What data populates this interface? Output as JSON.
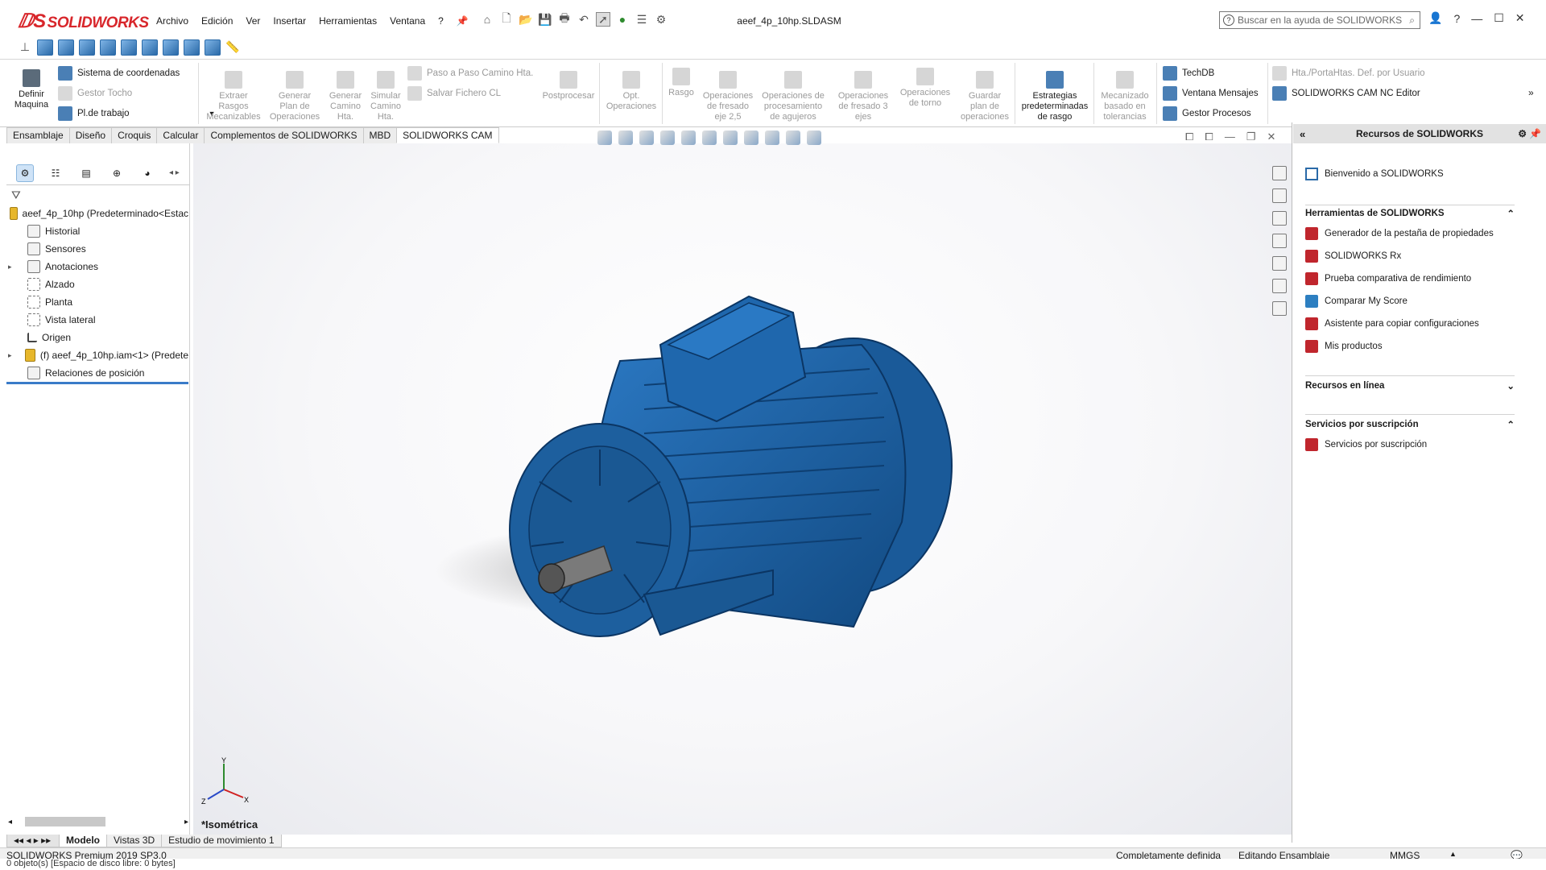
{
  "app": {
    "logo": "SOLIDWORKS",
    "doc_title": "aeef_4p_10hp.SLDASM",
    "menu": [
      "Archivo",
      "Edición",
      "Ver",
      "Insertar",
      "Herramientas",
      "Ventana",
      "?"
    ],
    "search_placeholder": "Buscar en la ayuda de SOLIDWORKS"
  },
  "ribbon": {
    "definir": "Definir\nMaquina",
    "coord": "Sistema de coordenadas",
    "gestor_tocho": "Gestor Tocho",
    "pl_trabajo": "Pl.de trabajo",
    "extraer": "Extraer\nRasgos\nMecanizables",
    "generar_plan": "Generar\nPlan de\nOperaciones",
    "generar_camino": "Generar\nCamino\nHta.",
    "simular": "Simular\nCamino\nHta.",
    "paso_a_paso": "Paso a Paso Camino Hta.",
    "salvar_cl": "Salvar Fichero CL",
    "postprocesar": "Postprocesar",
    "opt_op": "Opt.\nOperaciones",
    "rasgo": "Rasgo",
    "op_fresado25": "Operaciones\nde fresado\neje 2,5",
    "op_agujeros": "Operaciones de\nprocesamiento\nde agujeros",
    "op_fresado3": "Operaciones\nde fresado 3\nejes",
    "op_torno": "Operaciones\nde torno",
    "guardar_plan": "Guardar\nplan de\noperaciones",
    "estrategias": "Estrategias\npredeterminadas\nde rasgo",
    "mecanizado_tol": "Mecanizado\nbasado en\ntolerancias",
    "techdb": "TechDB",
    "ventana_msg": "Ventana Mensajes",
    "gestor_procesos": "Gestor Procesos",
    "hta_porta": "Hta./PortaHtas. Def. por Usuario",
    "nc_editor": "SOLIDWORKS CAM NC Editor"
  },
  "tabs": [
    "Ensamblaje",
    "Diseño",
    "Croquis",
    "Calcular",
    "Complementos de SOLIDWORKS",
    "MBD",
    "SOLIDWORKS CAM"
  ],
  "active_tab": "SOLIDWORKS CAM",
  "tree": {
    "root": "aeef_4p_10hp  (Predeterminado<Estac",
    "items": [
      "Historial",
      "Sensores",
      "Anotaciones",
      "Alzado",
      "Planta",
      "Vista lateral",
      "Origen",
      "(f) aeef_4p_10hp.iam<1> (Predete",
      "Relaciones de posición"
    ]
  },
  "viewport": {
    "view_label": "*Isométrica",
    "triad": {
      "x": "X",
      "y": "Y",
      "z": "Z"
    },
    "model_color": "#1d5f9e"
  },
  "task_pane": {
    "title": "Recursos de SOLIDWORKS",
    "welcome": "Bienvenido a SOLIDWORKS",
    "tools_header": "Herramientas de SOLIDWORKS",
    "tools": [
      "Generador de la pestaña de propiedades",
      "SOLIDWORKS Rx",
      "Prueba comparativa de rendimiento",
      "Comparar My Score",
      "Asistente para copiar configuraciones",
      "Mis productos"
    ],
    "online_header": "Recursos en línea",
    "subscription_header": "Servicios por suscripción",
    "subscription_item": "Servicios por suscripción"
  },
  "bottom_tabs": [
    "Modelo",
    "Vistas 3D",
    "Estudio de movimiento 1"
  ],
  "status": {
    "product": "SOLIDWORKS Premium 2019 SP3.0",
    "definition": "Completamente definida",
    "mode": "Editando Ensamblaje",
    "units": "MMGS",
    "hint": "0 objeto(s) [Espacio de disco libre: 0 bytes]"
  }
}
